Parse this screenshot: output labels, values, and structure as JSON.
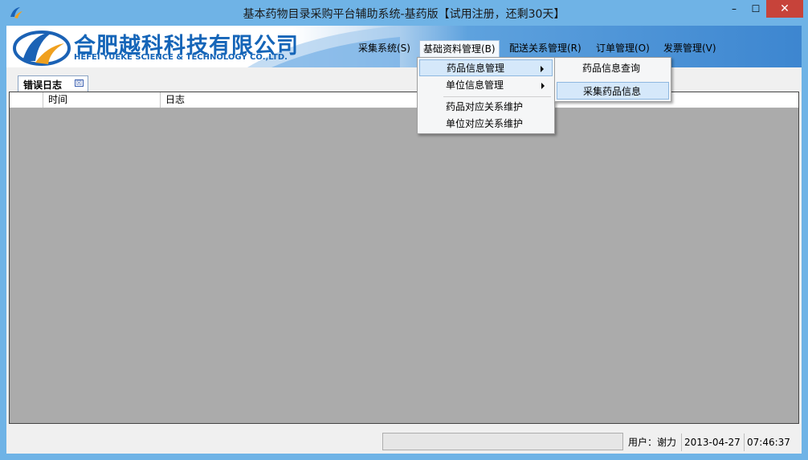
{
  "window": {
    "title": "基本药物目录采购平台辅助系统-基药版【试用注册，还剩30天】",
    "minimize": "–",
    "maximize": "☐",
    "close": "✕"
  },
  "banner": {
    "company_cn": "合肥越科科技有限公司",
    "company_en": "HEFEI YUEKE SCIENCE & TECHNOLOGY CO.,LTD."
  },
  "menu": [
    "采集系统(S)",
    "基础资料管理(B)",
    "配送关系管理(R)",
    "订单管理(O)",
    "发票管理(V)"
  ],
  "dropdown": {
    "items": [
      "药品信息管理",
      "单位信息管理",
      "药品对应关系维护",
      "单位对应关系维护"
    ]
  },
  "submenu": {
    "items": [
      "药品信息查询",
      "采集药品信息"
    ]
  },
  "tab": {
    "label": "错误日志",
    "close_icon": "☒"
  },
  "grid": {
    "columns": [
      "",
      "时间",
      "日志"
    ]
  },
  "status": {
    "user": "用户：谢力",
    "date": "2013-04-27",
    "time": "07:46:37"
  },
  "colors": {
    "titlebar": "#6fb3e6",
    "accent": "#1565b8",
    "close_button": "#c7433a",
    "grid_background": "#ababab"
  }
}
